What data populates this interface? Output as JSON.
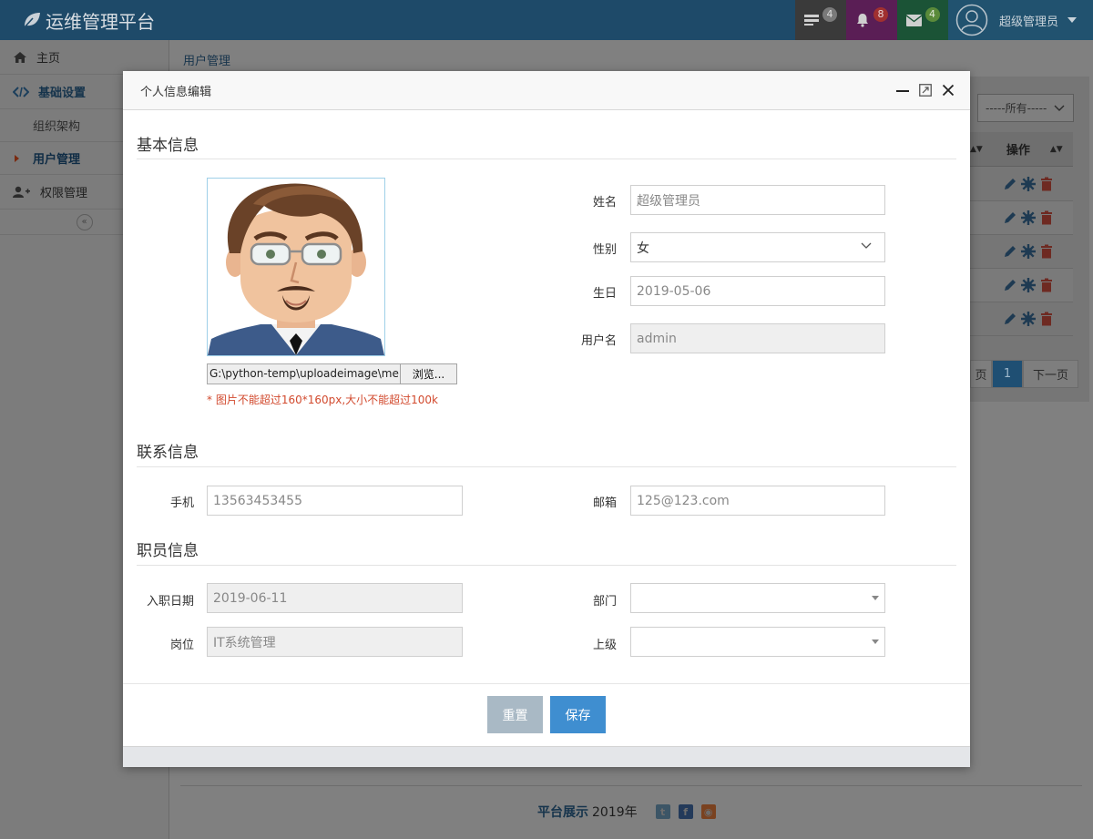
{
  "app": {
    "title": "运维管理平台"
  },
  "topbar": {
    "tasks_count": "4",
    "notifications_count": "8",
    "messages_count": "4",
    "user_name": "超级管理员",
    "colors": {
      "bar": "#1e4a69",
      "tasks": "#3a3a3a",
      "bell": "#5a1e55",
      "mail": "#1b5336"
    }
  },
  "sidebar": {
    "items": [
      {
        "label": "主页",
        "icon": "home-icon"
      },
      {
        "label": "基础设置",
        "icon": "code-icon"
      },
      {
        "label": "组织架构"
      },
      {
        "label": "用户管理"
      },
      {
        "label": "权限管理",
        "icon": "user-plus-icon"
      }
    ],
    "collapse": "«"
  },
  "page": {
    "breadcrumb": "用户管理",
    "filter_value": "-----所有-----",
    "table_header_op": "操作",
    "pager": {
      "prev": "页",
      "current": "1",
      "next": "下一页"
    }
  },
  "footer": {
    "brand": "平台展示",
    "year": "2019年"
  },
  "modal": {
    "title": "个人信息编辑",
    "sections": {
      "basic": "基本信息",
      "contact": "联系信息",
      "staff": "职员信息"
    },
    "photo": {
      "file_path": "G:\\python-temp\\uploadeimage\\me",
      "browse_label": "浏览...",
      "hint": "* 图片不能超过160*160px,大小不能超过100k"
    },
    "basic": {
      "name_label": "姓名",
      "name_value": "超级管理员",
      "gender_label": "性别",
      "gender_value": "女",
      "birthday_label": "生日",
      "birthday_value": "2019-05-06",
      "username_label": "用户名",
      "username_value": "admin"
    },
    "contact": {
      "phone_label": "手机",
      "phone_value": "13563453455",
      "email_label": "邮箱",
      "email_value": "125@123.com"
    },
    "staff": {
      "hire_date_label": "入职日期",
      "hire_date_value": "2019-06-11",
      "department_label": "部门",
      "department_value": "",
      "position_label": "岗位",
      "position_value": "IT系统管理",
      "superior_label": "上级",
      "superior_value": ""
    },
    "buttons": {
      "reset": "重置",
      "save": "保存"
    },
    "colors": {
      "reset": "#a9b9c5",
      "save": "#3f8ed0",
      "hint": "#d24a2e"
    }
  }
}
